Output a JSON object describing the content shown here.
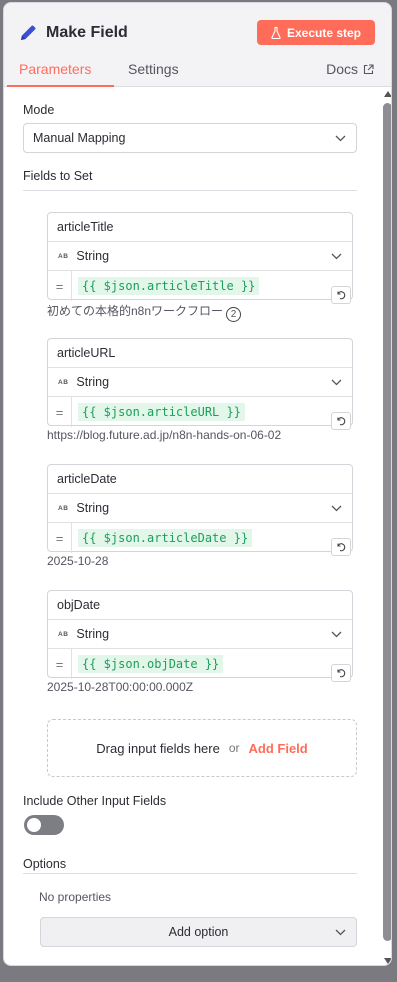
{
  "header": {
    "title": "Make Field",
    "execute_label": "Execute step",
    "accent": "#ff6d5a"
  },
  "tabs": [
    {
      "label": "Parameters",
      "active": true
    },
    {
      "label": "Settings",
      "active": false
    },
    {
      "label": "Docs",
      "active": false
    }
  ],
  "mode": {
    "label": "Mode",
    "value": "Manual Mapping"
  },
  "fields_section": {
    "label": "Fields to Set",
    "fields": [
      {
        "name": "articleTitle",
        "type_badge": "AB",
        "type": "String",
        "expression": "{{ $json.articleTitle }}",
        "preview": "初めての本格的n8nワークフロー",
        "preview_badge": "2"
      },
      {
        "name": "articleURL",
        "type_badge": "AB",
        "type": "String",
        "expression": "{{ $json.articleURL }}",
        "preview": "https://blog.future.ad.jp/n8n-hands-on-06-02"
      },
      {
        "name": "articleDate",
        "type_badge": "AB",
        "type": "String",
        "expression": "{{ $json.articleDate }}",
        "preview": "2025-10-28"
      },
      {
        "name": "objDate",
        "type_badge": "AB",
        "type": "String",
        "expression": "{{ $json.objDate }}",
        "preview": "2025-10-28T00:00:00.000Z"
      }
    ],
    "equals_sign": "=",
    "dropzone_text": "Drag input fields here",
    "dropzone_or": "or",
    "add_field_label": "Add Field"
  },
  "include_other": {
    "label": "Include Other Input Fields",
    "enabled": false
  },
  "options": {
    "label": "Options",
    "empty_text": "No properties",
    "add_option_label": "Add option"
  }
}
